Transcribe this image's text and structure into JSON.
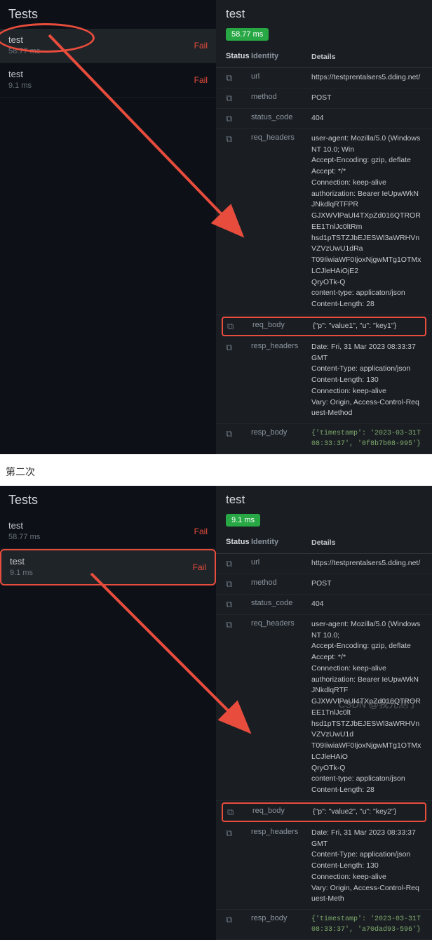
{
  "panel1": {
    "tests_header": "Tests",
    "right_header": "test",
    "badge": "58.77 ms",
    "tests": [
      {
        "name": "test",
        "time": "58.77 ms",
        "status": "Fail"
      },
      {
        "name": "test",
        "time": "9.1 ms",
        "status": "Fail"
      }
    ],
    "headers": {
      "status": "Status",
      "identity": "Identity",
      "details": "Details"
    },
    "rows": [
      {
        "identity": "url",
        "details": "https://testprentalsers5.dding.net/"
      },
      {
        "identity": "method",
        "details": "POST"
      },
      {
        "identity": "status_code",
        "details": "404"
      },
      {
        "identity": "req_headers",
        "details": "user-agent: Mozilla/5.0 (Windows NT 10.0; Win\nAccept-Encoding: gzip, deflate\nAccept: */*\nConnection: keep-alive\nauthorization: Bearer IeUpwWkNJNkdlqRTFPR\nGJXWVlPaUI4TXpZd016QTROREE1TnlJc0ltRm\nhsd1pTSTZJbEJESWl3aWRHVnVZVzUwU1dRa\nT09IiwiaWF0IjoxNjgwMTg1OTMxLCJleHAiOjE2\nQryOTk-Q\ncontent-type: applicaton/json\nContent-Length: 28"
      },
      {
        "identity": "req_body",
        "details": "{\"p\": \"value1\", \"u\": \"key1\"}"
      },
      {
        "identity": "resp_headers",
        "details": "Date: Fri, 31 Mar 2023 08:33:37 GMT\nContent-Type: application/json\nContent-Length: 130\nConnection: keep-alive\nVary: Origin, Access-Control-Request-Method"
      },
      {
        "identity": "resp_body",
        "details": "{'timestamp': '2023-03-31T08:33:37', '0f8b7b08-995'}"
      }
    ]
  },
  "divider_label": "第二次",
  "panel2": {
    "tests_header": "Tests",
    "right_header": "test",
    "badge": "9.1 ms",
    "tests": [
      {
        "name": "test",
        "time": "58.77 ms",
        "status": "Fail"
      },
      {
        "name": "test",
        "time": "9.1 ms",
        "status": "Fail"
      }
    ],
    "headers": {
      "status": "Status",
      "identity": "Identity",
      "details": "Details"
    },
    "rows": [
      {
        "identity": "url",
        "details": "https://testprentalsers5.dding.net/"
      },
      {
        "identity": "method",
        "details": "POST"
      },
      {
        "identity": "status_code",
        "details": "404"
      },
      {
        "identity": "req_headers",
        "details": "user-agent: Mozilla/5.0 (Windows NT 10.0;\nAccept-Encoding: gzip, deflate\nAccept: */*\nConnection: keep-alive\nauthorization: Bearer IeUpwWkNJNkdlqRTF\nGJXWVlPaUI4TXpZd016QTROREE1TnlJc0lt\nhsd1pTSTZJbEJESWl3aWRHVnVZVzUwU1d\nT09IiwiaWF0IjoxNjgwMTg1OTMxLCJleHAiO\nQryOTk-Q\ncontent-type: applicaton/json\nContent-Length: 28"
      },
      {
        "identity": "req_body",
        "details": "{\"p\": \"value2\", \"u\": \"key2\"}"
      },
      {
        "identity": "resp_headers",
        "details": "Date: Fri, 31 Mar 2023 08:33:37 GMT\nContent-Type: application/json\nContent-Length: 130\nConnection: keep-alive\nVary: Origin, Access-Control-Request-Meth"
      },
      {
        "identity": "resp_body",
        "details": "{'timestamp': '2023-03-31T08:33:37', 'a70dad93-596'}"
      }
    ]
  },
  "watermark": "CSDN @我先测了"
}
